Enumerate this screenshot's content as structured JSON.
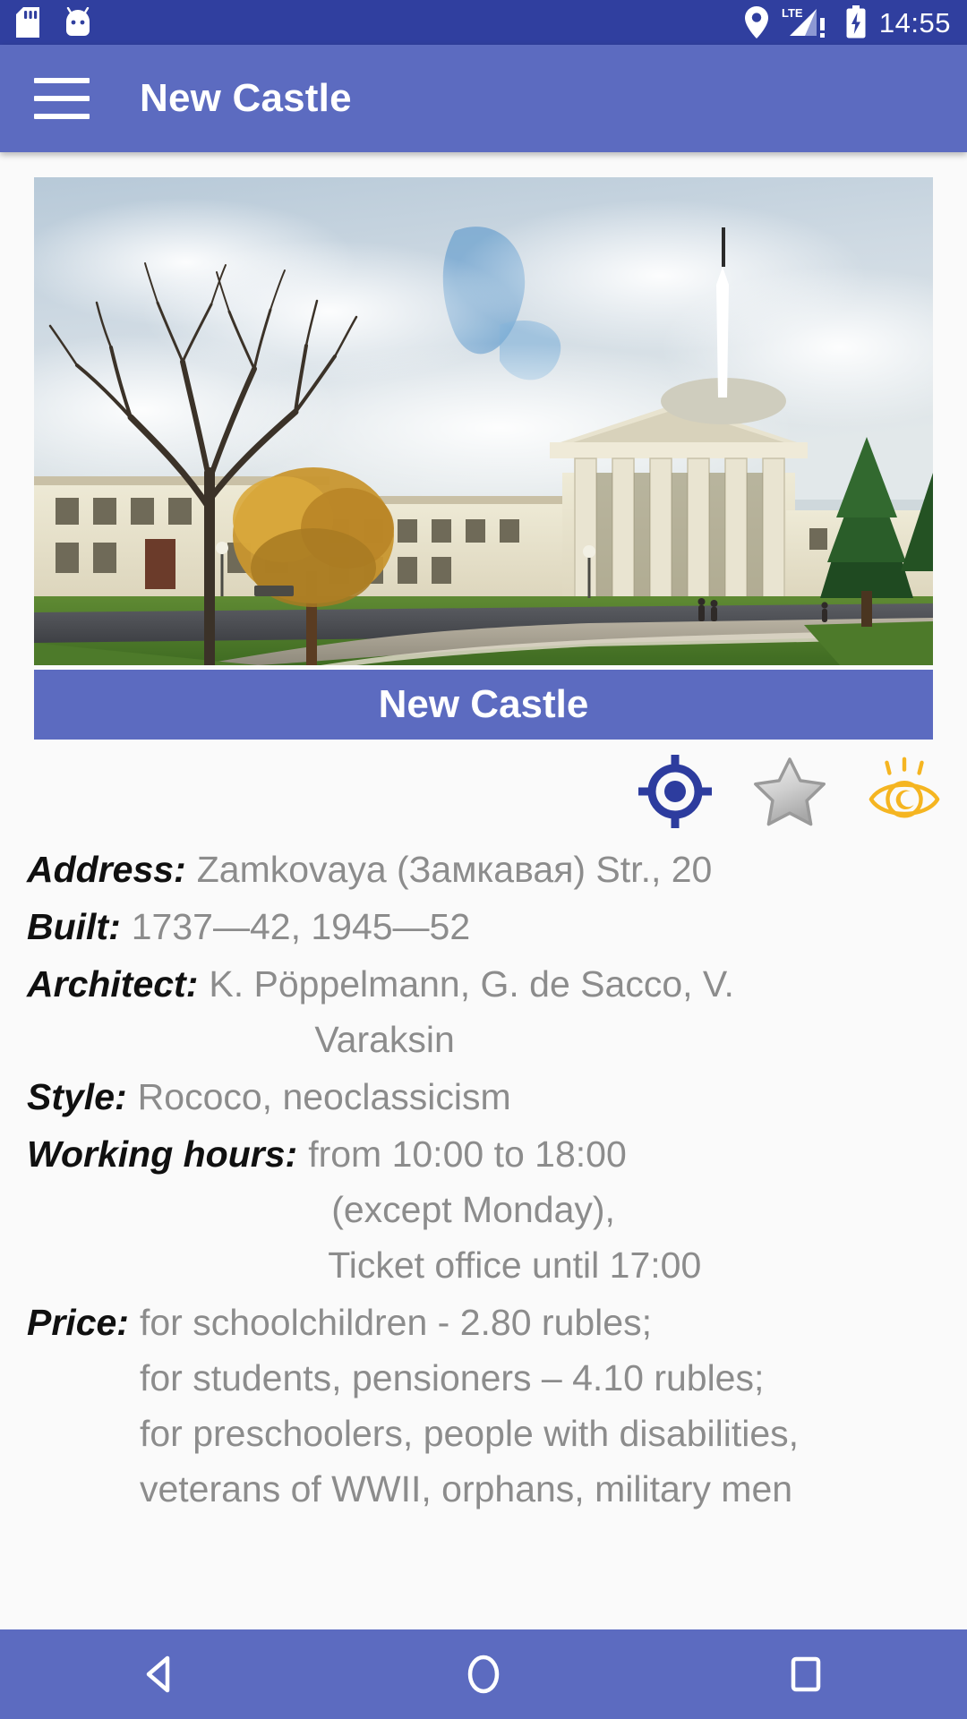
{
  "status_bar": {
    "icons_left": [
      "sd-card-icon",
      "android-robot-icon"
    ],
    "icons_right": [
      "location-pin-icon",
      "lte-signal-icon",
      "battery-charging-icon"
    ],
    "network_label": "LTE",
    "time": "14:55",
    "background_color": "#303f9f"
  },
  "app_bar": {
    "menu_icon": "hamburger-menu-icon",
    "title": "New Castle",
    "background_color": "#5c6bc0"
  },
  "photo": {
    "alt": "New Castle neoclassical building with columned portico, bare tree and autumn tree on lawn",
    "caption": "New Castle",
    "caption_background": "#5c6bc0"
  },
  "actions": [
    {
      "name": "locate-on-map-icon",
      "label": "Show on map",
      "color": "#2d3c9e"
    },
    {
      "name": "favorite-star-icon",
      "label": "Add to favourites",
      "color": "#b0b0b0"
    },
    {
      "name": "visited-eye-icon",
      "label": "Mark as visited",
      "color": "#f5b521"
    }
  ],
  "info": [
    {
      "label": "Address:",
      "lines": [
        "Zamkovaya (Замкавая) Str., 20"
      ],
      "indent": "none"
    },
    {
      "label": "Built:",
      "lines": [
        "1737—42, 1945—52"
      ],
      "indent": "none"
    },
    {
      "label": "Architect:",
      "lines": [
        "K. Pöppelmann, G. de Sacco,  V.",
        "Varaksin"
      ],
      "indent": "hang"
    },
    {
      "label": "Style:",
      "lines": [
        "Rococo, neoclassicism"
      ],
      "indent": "none"
    },
    {
      "label": "Working hours:",
      "lines": [
        "from 10:00 to 18:00",
        "(except Monday),",
        "Ticket office until 17:00"
      ],
      "indent": "center"
    },
    {
      "label": "Price:",
      "lines": [
        "for schoolchildren - 2.80 rubles;",
        "for students, pensioners – 4.10 rubles;",
        "for preschoolers, people with disabilities,",
        "veterans of WWII, orphans, military men"
      ],
      "indent": "hang"
    }
  ],
  "nav_bar": {
    "buttons": [
      {
        "name": "back-button",
        "label": "Back"
      },
      {
        "name": "home-button",
        "label": "Home"
      },
      {
        "name": "recents-button",
        "label": "Recents"
      }
    ],
    "background_color": "#5c6bc0"
  },
  "theme": {
    "primary": "#5c6bc0",
    "primary_dark": "#303f9f",
    "page_background": "#fafafa",
    "label_color": "#101010",
    "value_color": "#8c8c8c"
  }
}
